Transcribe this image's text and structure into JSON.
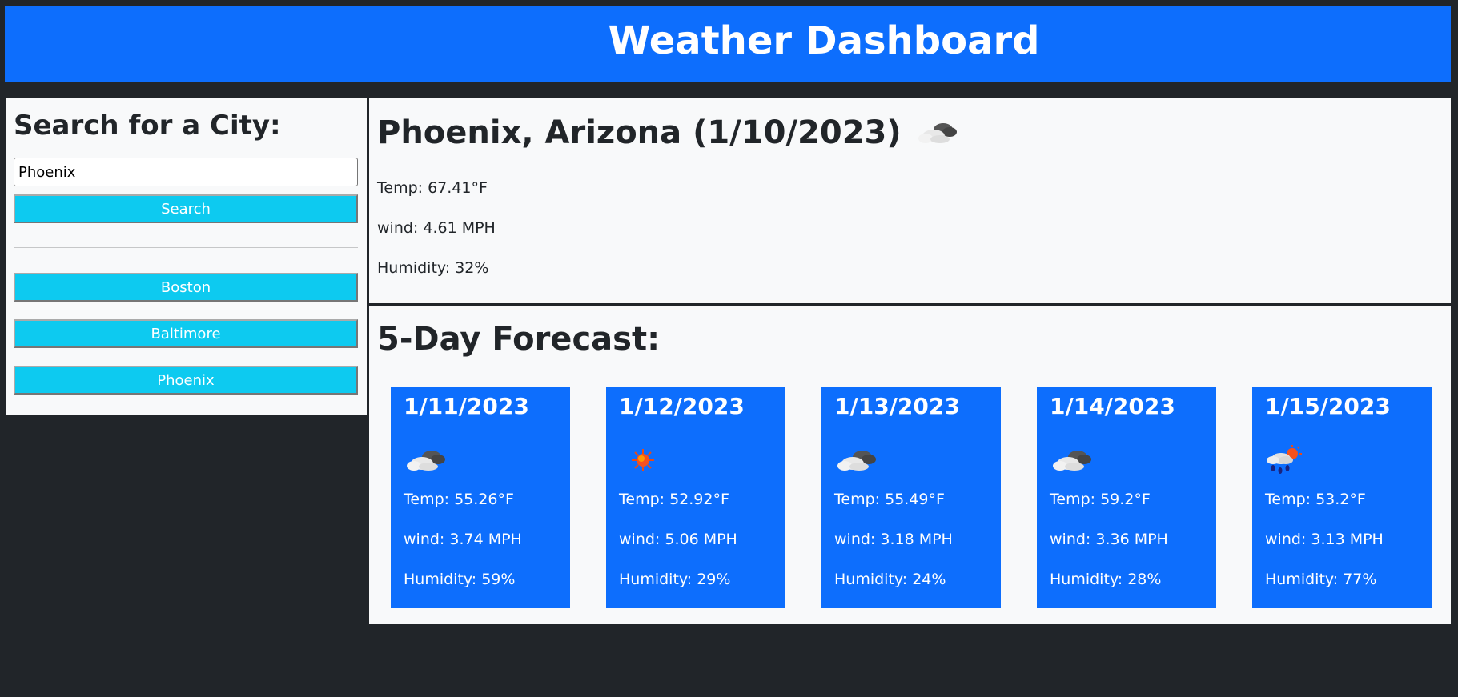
{
  "header": {
    "title": "Weather Dashboard"
  },
  "search": {
    "heading": "Search for a City:",
    "value": "Phoenix",
    "button_label": "Search"
  },
  "history": [
    {
      "label": "Boston"
    },
    {
      "label": "Baltimore"
    },
    {
      "label": "Phoenix"
    }
  ],
  "current": {
    "title": "Phoenix, Arizona (1/10/2023)",
    "icon": "partly-cloudy-icon",
    "temp": "Temp: 67.41°F",
    "wind": "wind: 4.61 MPH",
    "humidity": "Humidity: 32%"
  },
  "forecast": {
    "heading": "5-Day Forecast:",
    "days": [
      {
        "date": "1/11/2023",
        "icon": "partly-cloudy-icon",
        "temp": "Temp: 55.26°F",
        "wind": "wind: 3.74 MPH",
        "humidity": "Humidity: 59%"
      },
      {
        "date": "1/12/2023",
        "icon": "sun-icon",
        "temp": "Temp: 52.92°F",
        "wind": "wind: 5.06 MPH",
        "humidity": "Humidity: 29%"
      },
      {
        "date": "1/13/2023",
        "icon": "partly-cloudy-icon",
        "temp": "Temp: 55.49°F",
        "wind": "wind: 3.18 MPH",
        "humidity": "Humidity: 24%"
      },
      {
        "date": "1/14/2023",
        "icon": "partly-cloudy-icon",
        "temp": "Temp: 59.2°F",
        "wind": "wind: 3.36 MPH",
        "humidity": "Humidity: 28%"
      },
      {
        "date": "1/15/2023",
        "icon": "rain-sun-icon",
        "temp": "Temp: 53.2°F",
        "wind": "wind: 3.13 MPH",
        "humidity": "Humidity: 77%"
      }
    ]
  },
  "colors": {
    "primary": "#0d6efd",
    "info": "#0dcaf0",
    "dark": "#212529",
    "light": "#f8f9fa"
  }
}
